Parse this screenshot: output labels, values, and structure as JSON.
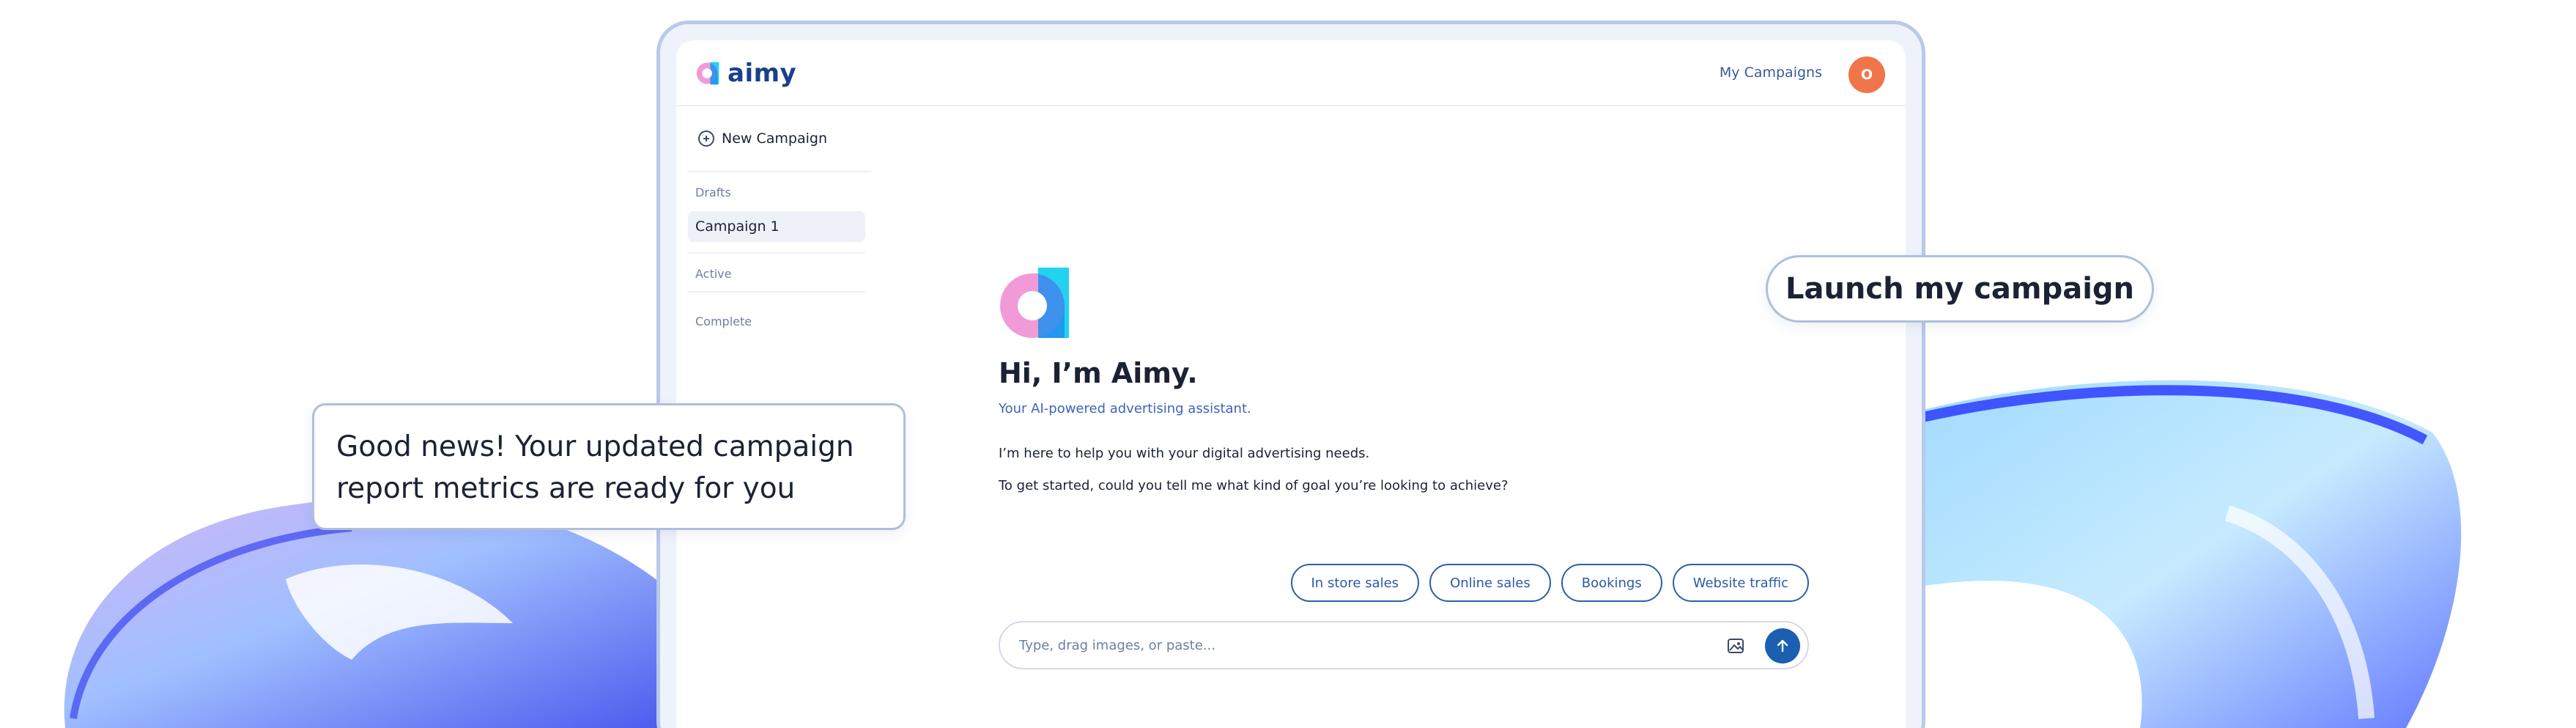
{
  "app": {
    "logo_text": "aimy",
    "nav_link": "My Campaigns",
    "avatar_initial": "O"
  },
  "sidebar": {
    "new_campaign": "New Campaign",
    "drafts_label": "Drafts",
    "drafts": [
      {
        "label": "Campaign 1",
        "selected": true
      }
    ],
    "active_label": "Active",
    "complete_label": "Complete"
  },
  "assistant": {
    "greeting": "Hi, I’m Aimy.",
    "subtitle": "Your AI-powered advertising assistant.",
    "message_1": "I’m here to help you with your digital advertising needs.",
    "message_2": "To get started, could you tell me what kind of goal you’re looking to achieve?",
    "suggestions": [
      "In store sales",
      "Online sales",
      "Bookings",
      "Website traffic"
    ],
    "composer_placeholder": "Type, drag images, or paste..."
  },
  "callouts": {
    "good_news": "Good news! Your updated campaign report metrics are ready for you",
    "launch": "Launch my campaign"
  },
  "icons": {
    "new_campaign": "plus-circle-icon",
    "attach": "image-icon",
    "send": "arrow-up-icon"
  },
  "colors": {
    "brand_navy": "#1a3f8c",
    "accent_blue": "#1a5fb0",
    "avatar_orange": "#f0754a",
    "logo_pink": "#f09bd8",
    "logo_cyan": "#22d3f0"
  }
}
